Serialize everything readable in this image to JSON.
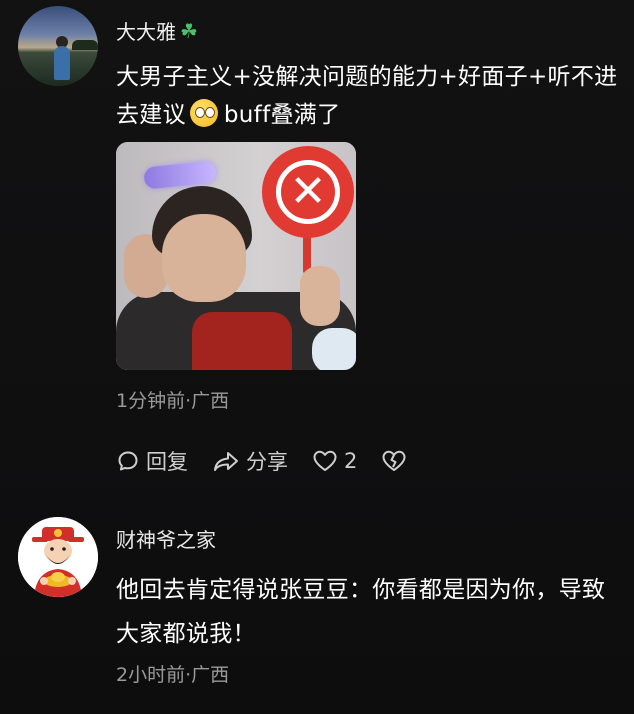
{
  "comments": [
    {
      "username": "大大雅",
      "name_badge_icon": "four-leaf-clover-icon",
      "text_before_emoji": "大男子主义+没解决问题的能力+好面子+听不进去建议",
      "emoji_icon": "rolling-eyes-emoji-icon",
      "text_after_emoji": "buff叠满了",
      "meta": "1分钟前·广西",
      "actions": {
        "reply_label": "回复",
        "share_label": "分享",
        "like_count": "2"
      }
    },
    {
      "username": "财神爷之家",
      "text": "他回去肯定得说张豆豆：你看都是因为你，导致大家都说我！",
      "meta": "2小时前·广西"
    }
  ],
  "colors": {
    "background": "#0f0f10",
    "primary_text": "#ffffff",
    "secondary_text": "#9a9a9a",
    "clover": "#4cc06a",
    "sign_red": "#e03a32"
  }
}
